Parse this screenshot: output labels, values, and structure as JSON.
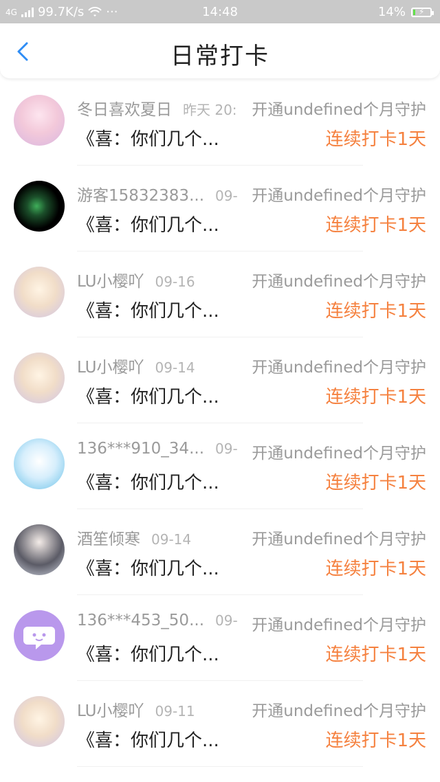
{
  "status_bar": {
    "network": "4G",
    "speed": "99.7K/s",
    "wifi_icon": "wifi-icon",
    "more": "···",
    "time": "14:48",
    "battery_percent": "14%",
    "battery_level": 0.14
  },
  "header": {
    "title": "日常打卡",
    "back_icon": "chevron-left-icon"
  },
  "entries": [
    {
      "name": "冬日喜欢夏日",
      "date": "昨天 20:",
      "guard": "开通undefined个月守护",
      "message": "《喜：你们几个...",
      "streak": "连续打卡1天"
    },
    {
      "name": "游客15832383...",
      "date": "09-",
      "guard": "开通undefined个月守护",
      "message": "《喜：你们几个...",
      "streak": "连续打卡1天"
    },
    {
      "name": "LU小樱吖",
      "date": "09-16",
      "guard": "开通undefined个月守护",
      "message": "《喜：你们几个...",
      "streak": "连续打卡1天"
    },
    {
      "name": "LU小樱吖",
      "date": "09-14",
      "guard": "开通undefined个月守护",
      "message": "《喜：你们几个...",
      "streak": "连续打卡1天"
    },
    {
      "name": "136***910_34...",
      "date": "09-",
      "guard": "开通undefined个月守护",
      "message": "《喜：你们几个...",
      "streak": "连续打卡1天"
    },
    {
      "name": "酒笙倾寒",
      "date": "09-14",
      "guard": "开通undefined个月守护",
      "message": "《喜：你们几个...",
      "streak": "连续打卡1天"
    },
    {
      "name": "136***453_50...",
      "date": "09-",
      "guard": "开通undefined个月守护",
      "message": "《喜：你们几个...",
      "streak": "连续打卡1天"
    },
    {
      "name": "LU小樱吖",
      "date": "09-11",
      "guard": "开通undefined个月守护",
      "message": "《喜：你们几个...",
      "streak": "连续打卡1天"
    }
  ],
  "colors": {
    "accent_blue": "#2f8df5",
    "streak_orange": "#f5813f",
    "status_bar_bg": "#c9c9c9"
  }
}
